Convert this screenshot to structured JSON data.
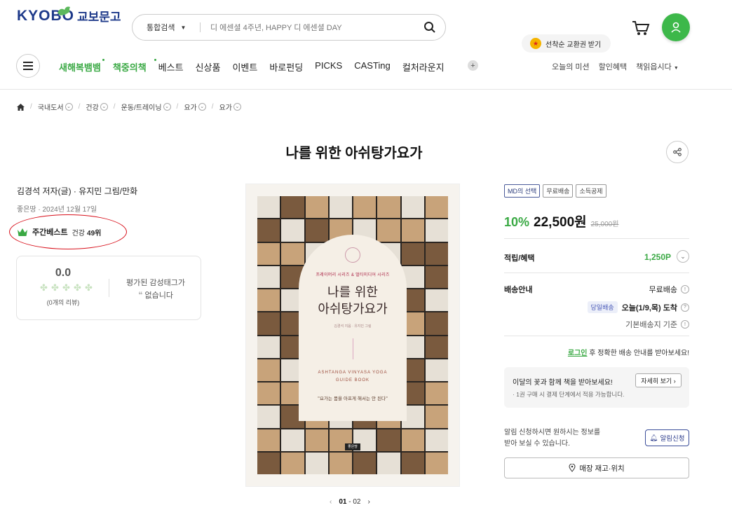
{
  "header": {
    "logo_en": "KYOBO",
    "logo_ko": "교보문고",
    "search_category": "통합검색",
    "search_placeholder": "디 에센셜 4주년, HAPPY 디 에센셜 DAY",
    "tooltip": "선착순 교환권 받기",
    "nav_items": [
      "새해복뱀뱀",
      "책중의책",
      "베스트",
      "신상품",
      "이벤트",
      "바로펀딩",
      "PICKS",
      "CASTing",
      "컬처라운지"
    ],
    "nav_more": "+",
    "right_links": [
      "오늘의 미션",
      "할인혜택",
      "책읽읍시다"
    ]
  },
  "breadcrumb": [
    "국내도서",
    "건강",
    "운동/트레이닝",
    "요가",
    "요가"
  ],
  "book": {
    "title": "나를 위한 아쉬탕가요가",
    "author": "김경석 저자(글) · 유지민 그림/만화",
    "publisher_date": "좋은땅 · 2024년 12월 17일",
    "best_label": "주간베스트",
    "best_category": "건강",
    "best_rank": "49위"
  },
  "review": {
    "score": "0.0",
    "count_text": "(0개의 리뷰)",
    "tag_line1": "평가된 감성태그가",
    "tag_line2": "없습니다"
  },
  "cover": {
    "series": "프레이머리 시리즈 & 멀티미디어 시리즈",
    "title_line1": "나를 위한",
    "title_line2": "아쉬탕가요가",
    "authors": "김경석 지음 · 유지민 그림",
    "eng_line1": "ASHTANGA VINYASA YOGA",
    "eng_line2": "GUIDE BOOK",
    "quote": "\"요가는 몸을 아프게 해서는 안 된다\"",
    "publisher_mark": "좋은땅"
  },
  "pager": {
    "current": "01",
    "total": "02"
  },
  "purchase": {
    "badges": [
      "MD의 선택",
      "무료배송",
      "소득공제"
    ],
    "discount": "10%",
    "price": "22,500원",
    "original_price": "25,000원",
    "points_label": "적립/혜택",
    "points_value": "1,250P",
    "shipping_label": "배송안내",
    "shipping_free": "무료배송",
    "sameday_tag": "당일배송",
    "arrival": "오늘(1/9,목) 도착",
    "shipping_base": "기본배송지 기준",
    "login_link": "로그인",
    "login_text": " 후 정확한 배송 안내를 받아보세요!",
    "gift_title": "이달의 꽃과 함께 책을 받아보세요!",
    "gift_sub": "· 1권 구매 시 결제 단계에서 적용 가능합니다.",
    "gift_button": "자세히 보기 ›",
    "alarm_line1": "알림 신청하시면 원하시는 정보를",
    "alarm_line2": "받아 보실 수 있습니다.",
    "alarm_button": "알림신청",
    "store_button": "매장 재고·위치"
  },
  "colors": {
    "accent_green": "#3aa944",
    "brand_blue": "#1e3a8a",
    "highlight_red": "#d8101b"
  }
}
